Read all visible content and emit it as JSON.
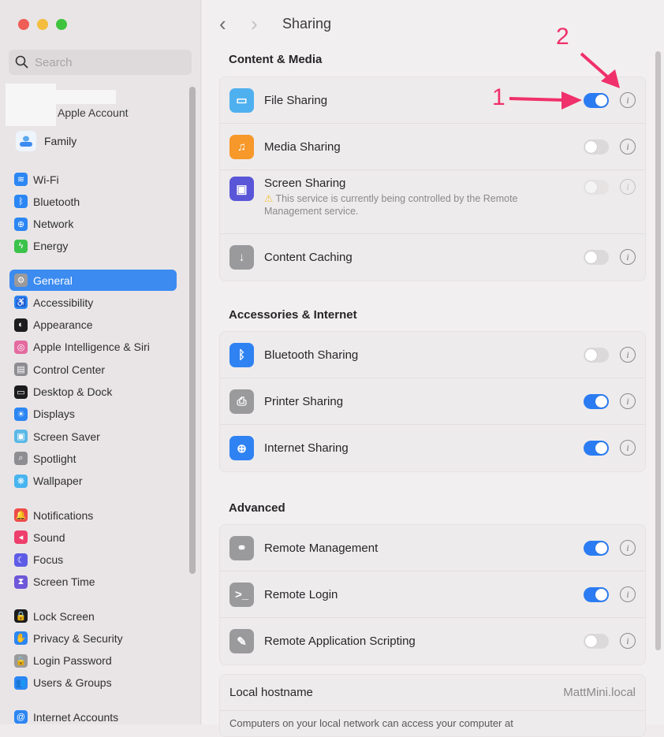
{
  "window": {
    "title": "Sharing"
  },
  "traffic_lights": {
    "close": "#ee5e57",
    "minimize": "#f5bd3f",
    "zoom": "#3fc33f"
  },
  "sidebar": {
    "search_placeholder": "Search",
    "account_label": "Apple Account",
    "family_label": "Family",
    "groups": [
      [
        {
          "label": "Wi-Fi",
          "icon": "wifi-icon",
          "color": "#2c86f3",
          "glyph": "≋"
        },
        {
          "label": "Bluetooth",
          "icon": "bluetooth-icon",
          "color": "#2c86f3",
          "glyph": "ᛒ"
        },
        {
          "label": "Network",
          "icon": "network-globe-icon",
          "color": "#2c86f3",
          "glyph": "⊕"
        },
        {
          "label": "Energy",
          "icon": "energy-bolt-icon",
          "color": "#3bc24a",
          "glyph": "ϟ"
        }
      ],
      [
        {
          "label": "General",
          "icon": "general-gear-icon",
          "color": "#9a9a9c",
          "glyph": "⚙",
          "selected": true
        },
        {
          "label": "Accessibility",
          "icon": "accessibility-icon",
          "color": "#2c86f3",
          "glyph": "♿"
        },
        {
          "label": "Appearance",
          "icon": "appearance-icon",
          "color": "#1c1c1e",
          "glyph": "◐"
        },
        {
          "label": "Apple Intelligence & Siri",
          "icon": "siri-icon",
          "color": "#e46aa0",
          "glyph": "◎"
        },
        {
          "label": "Control Center",
          "icon": "control-center-icon",
          "color": "#8e8e92",
          "glyph": "▤"
        },
        {
          "label": "Desktop & Dock",
          "icon": "desktop-dock-icon",
          "color": "#1c1c1e",
          "glyph": "▭"
        },
        {
          "label": "Displays",
          "icon": "displays-icon",
          "color": "#2c86f3",
          "glyph": "☀"
        },
        {
          "label": "Screen Saver",
          "icon": "screen-saver-icon",
          "color": "#5ab8e6",
          "glyph": "▣"
        },
        {
          "label": "Spotlight",
          "icon": "spotlight-icon",
          "color": "#8e8e92",
          "glyph": "⌕"
        },
        {
          "label": "Wallpaper",
          "icon": "wallpaper-icon",
          "color": "#48b4f0",
          "glyph": "❋"
        }
      ],
      [
        {
          "label": "Notifications",
          "icon": "notifications-icon",
          "color": "#ee4b4b",
          "glyph": "🔔"
        },
        {
          "label": "Sound",
          "icon": "sound-icon",
          "color": "#ee3e6c",
          "glyph": "◂"
        },
        {
          "label": "Focus",
          "icon": "focus-moon-icon",
          "color": "#5e5ce6",
          "glyph": "☾"
        },
        {
          "label": "Screen Time",
          "icon": "screen-time-icon",
          "color": "#6e58d8",
          "glyph": "⧗"
        }
      ],
      [
        {
          "label": "Lock Screen",
          "icon": "lock-screen-icon",
          "color": "#1c1c1e",
          "glyph": "🔒"
        },
        {
          "label": "Privacy & Security",
          "icon": "privacy-hand-icon",
          "color": "#2c86f3",
          "glyph": "✋"
        },
        {
          "label": "Login Password",
          "icon": "login-password-icon",
          "color": "#9a9a9c",
          "glyph": "🔒"
        },
        {
          "label": "Users & Groups",
          "icon": "users-groups-icon",
          "color": "#2c86f3",
          "glyph": "👥"
        }
      ],
      [
        {
          "label": "Internet Accounts",
          "icon": "internet-accounts-icon",
          "color": "#2c86f3",
          "glyph": "@"
        }
      ]
    ]
  },
  "main": {
    "back_glyph": "‹",
    "forward_glyph": "›",
    "sections": [
      {
        "heading": "Content & Media",
        "rows": [
          {
            "label": "File Sharing",
            "icon": "folder-icon",
            "color": "#4fb0ef",
            "glyph": "▭",
            "on": true,
            "disabled": false
          },
          {
            "label": "Media Sharing",
            "icon": "media-sharing-icon",
            "color": "#f6982a",
            "glyph": "♫",
            "on": false,
            "disabled": false
          },
          {
            "label": "Screen Sharing",
            "icon": "screen-sharing-icon",
            "color": "#5a56d8",
            "glyph": "▣",
            "on": false,
            "disabled": true,
            "warning": "This service is currently being controlled by the Remote Management service."
          },
          {
            "label": "Content Caching",
            "icon": "content-caching-icon",
            "color": "#9a9a9c",
            "glyph": "↓",
            "on": false,
            "disabled": false
          }
        ]
      },
      {
        "heading": "Accessories & Internet",
        "rows": [
          {
            "label": "Bluetooth Sharing",
            "icon": "bluetooth-sharing-icon",
            "color": "#2f82f2",
            "glyph": "ᛒ",
            "on": false,
            "disabled": false
          },
          {
            "label": "Printer Sharing",
            "icon": "printer-icon",
            "color": "#9a9a9c",
            "glyph": "⎙",
            "on": true,
            "disabled": false
          },
          {
            "label": "Internet Sharing",
            "icon": "internet-globe-icon",
            "color": "#2f82f2",
            "glyph": "⊕",
            "on": true,
            "disabled": false
          }
        ]
      },
      {
        "heading": "Advanced",
        "rows": [
          {
            "label": "Remote Management",
            "icon": "binoculars-icon",
            "color": "#9a9a9c",
            "glyph": "⚭",
            "on": true,
            "disabled": false
          },
          {
            "label": "Remote Login",
            "icon": "terminal-icon",
            "color": "#9a9a9c",
            "glyph": ">_",
            "on": true,
            "disabled": false
          },
          {
            "label": "Remote Application Scripting",
            "icon": "scripting-icon",
            "color": "#9a9a9c",
            "glyph": "✎",
            "on": false,
            "disabled": false
          }
        ]
      }
    ],
    "hostname_label": "Local hostname",
    "hostname_value": "MattMini.local",
    "hostname_desc": "Computers on your local network can access your computer at"
  },
  "annotations": {
    "one": "1",
    "two": "2",
    "color": "#f0306a"
  }
}
